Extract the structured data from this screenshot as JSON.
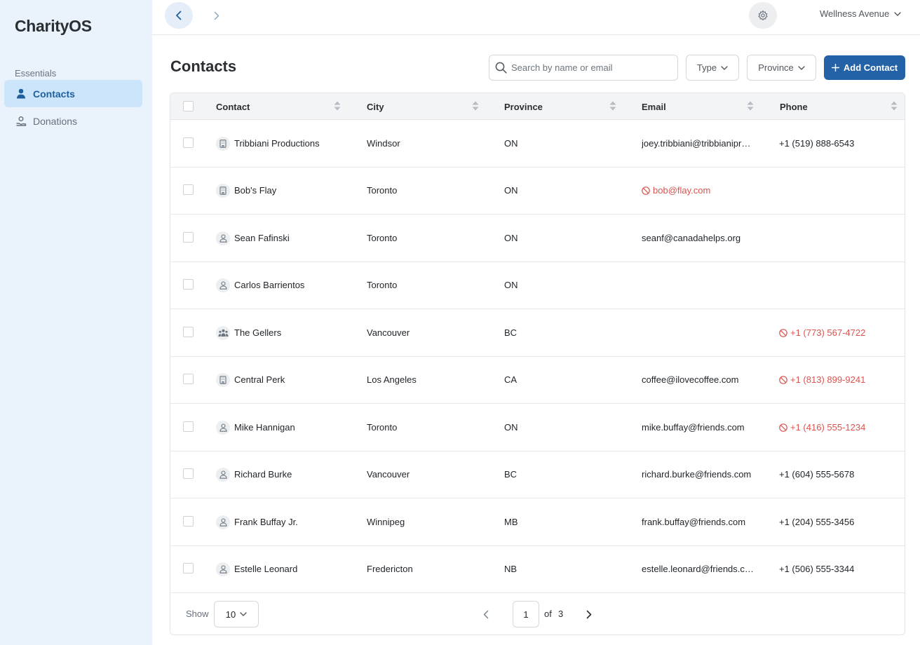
{
  "app": {
    "name": "CharityOS"
  },
  "sidebar": {
    "section_label": "Essentials",
    "items": [
      {
        "label": "Contacts",
        "icon": "person-icon",
        "active": true
      },
      {
        "label": "Donations",
        "icon": "donation-hand-icon",
        "active": false
      }
    ]
  },
  "topbar": {
    "org_name": "Wellness Avenue"
  },
  "page": {
    "title": "Contacts",
    "search_placeholder": "Search by name or email",
    "filter_type_label": "Type",
    "filter_province_label": "Province",
    "add_button_label": "Add Contact"
  },
  "table": {
    "columns": [
      "Contact",
      "City",
      "Province",
      "Email",
      "Phone"
    ],
    "rows": [
      {
        "type": "organization",
        "name": "Tribbiani Productions",
        "city": "Windsor",
        "province": "ON",
        "email": "joey.tribbiani@tribbianipro...",
        "email_invalid": false,
        "phone": "+1 (519) 888-6543",
        "phone_invalid": false
      },
      {
        "type": "organization",
        "name": "Bob's Flay",
        "city": "Toronto",
        "province": "ON",
        "email": "bob@flay.com",
        "email_invalid": true,
        "phone": "",
        "phone_invalid": false
      },
      {
        "type": "individual",
        "name": "Sean Fafinski",
        "city": "Toronto",
        "province": "ON",
        "email": "seanf@canadahelps.org",
        "email_invalid": false,
        "phone": "",
        "phone_invalid": false
      },
      {
        "type": "individual",
        "name": "Carlos Barrientos",
        "city": "Toronto",
        "province": "ON",
        "email": "",
        "email_invalid": false,
        "phone": "",
        "phone_invalid": false
      },
      {
        "type": "household",
        "name": "The Gellers",
        "city": "Vancouver",
        "province": "BC",
        "email": "",
        "email_invalid": false,
        "phone": "+1 (773) 567-4722",
        "phone_invalid": true
      },
      {
        "type": "organization",
        "name": "Central Perk",
        "city": "Los Angeles",
        "province": "CA",
        "email": "coffee@ilovecoffee.com",
        "email_invalid": false,
        "phone": "+1 (813) 899-9241",
        "phone_invalid": true
      },
      {
        "type": "individual",
        "name": "Mike Hannigan",
        "city": "Toronto",
        "province": "ON",
        "email": "mike.buffay@friends.com",
        "email_invalid": false,
        "phone": "+1 (416) 555-1234",
        "phone_invalid": true
      },
      {
        "type": "individual",
        "name": "Richard Burke",
        "city": "Vancouver",
        "province": "BC",
        "email": "richard.burke@friends.com",
        "email_invalid": false,
        "phone": "+1 (604) 555-5678",
        "phone_invalid": false
      },
      {
        "type": "individual",
        "name": "Frank Buffay Jr.",
        "city": "Winnipeg",
        "province": "MB",
        "email": "frank.buffay@friends.com",
        "email_invalid": false,
        "phone": "+1 (204) 555-3456",
        "phone_invalid": false
      },
      {
        "type": "individual",
        "name": "Estelle Leonard",
        "city": "Fredericton",
        "province": "NB",
        "email": "estelle.leonard@friends.com",
        "email_invalid": false,
        "phone": "+1 (506) 555-3344",
        "phone_invalid": false
      }
    ]
  },
  "pagination": {
    "show_label": "Show",
    "page_size": "10",
    "current_page": "1",
    "of_label": "of",
    "total_pages": "3"
  },
  "colors": {
    "sidebar_bg": "#eaf2fb",
    "active_nav_bg": "#cde5fb",
    "accent": "#2462a7",
    "invalid": "#d9534f"
  }
}
